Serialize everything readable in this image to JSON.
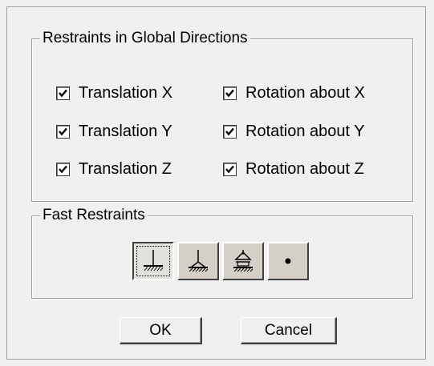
{
  "restraints_group": {
    "title": "Restraints in Global Directions",
    "items": [
      {
        "label": "Translation X",
        "checked": true
      },
      {
        "label": "Rotation about X",
        "checked": true
      },
      {
        "label": "Translation Y",
        "checked": true
      },
      {
        "label": "Rotation about Y",
        "checked": true
      },
      {
        "label": "Translation Z",
        "checked": true
      },
      {
        "label": "Rotation about Z",
        "checked": true
      }
    ]
  },
  "fast_restraints": {
    "title": "Fast Restraints",
    "buttons": [
      {
        "icon": "fixed-support-icon",
        "pressed": true
      },
      {
        "icon": "pinned-support-icon",
        "pressed": false
      },
      {
        "icon": "roller-support-icon",
        "pressed": false
      },
      {
        "icon": "free-node-icon",
        "pressed": false
      }
    ]
  },
  "actions": {
    "ok_label": "OK",
    "cancel_label": "Cancel"
  }
}
